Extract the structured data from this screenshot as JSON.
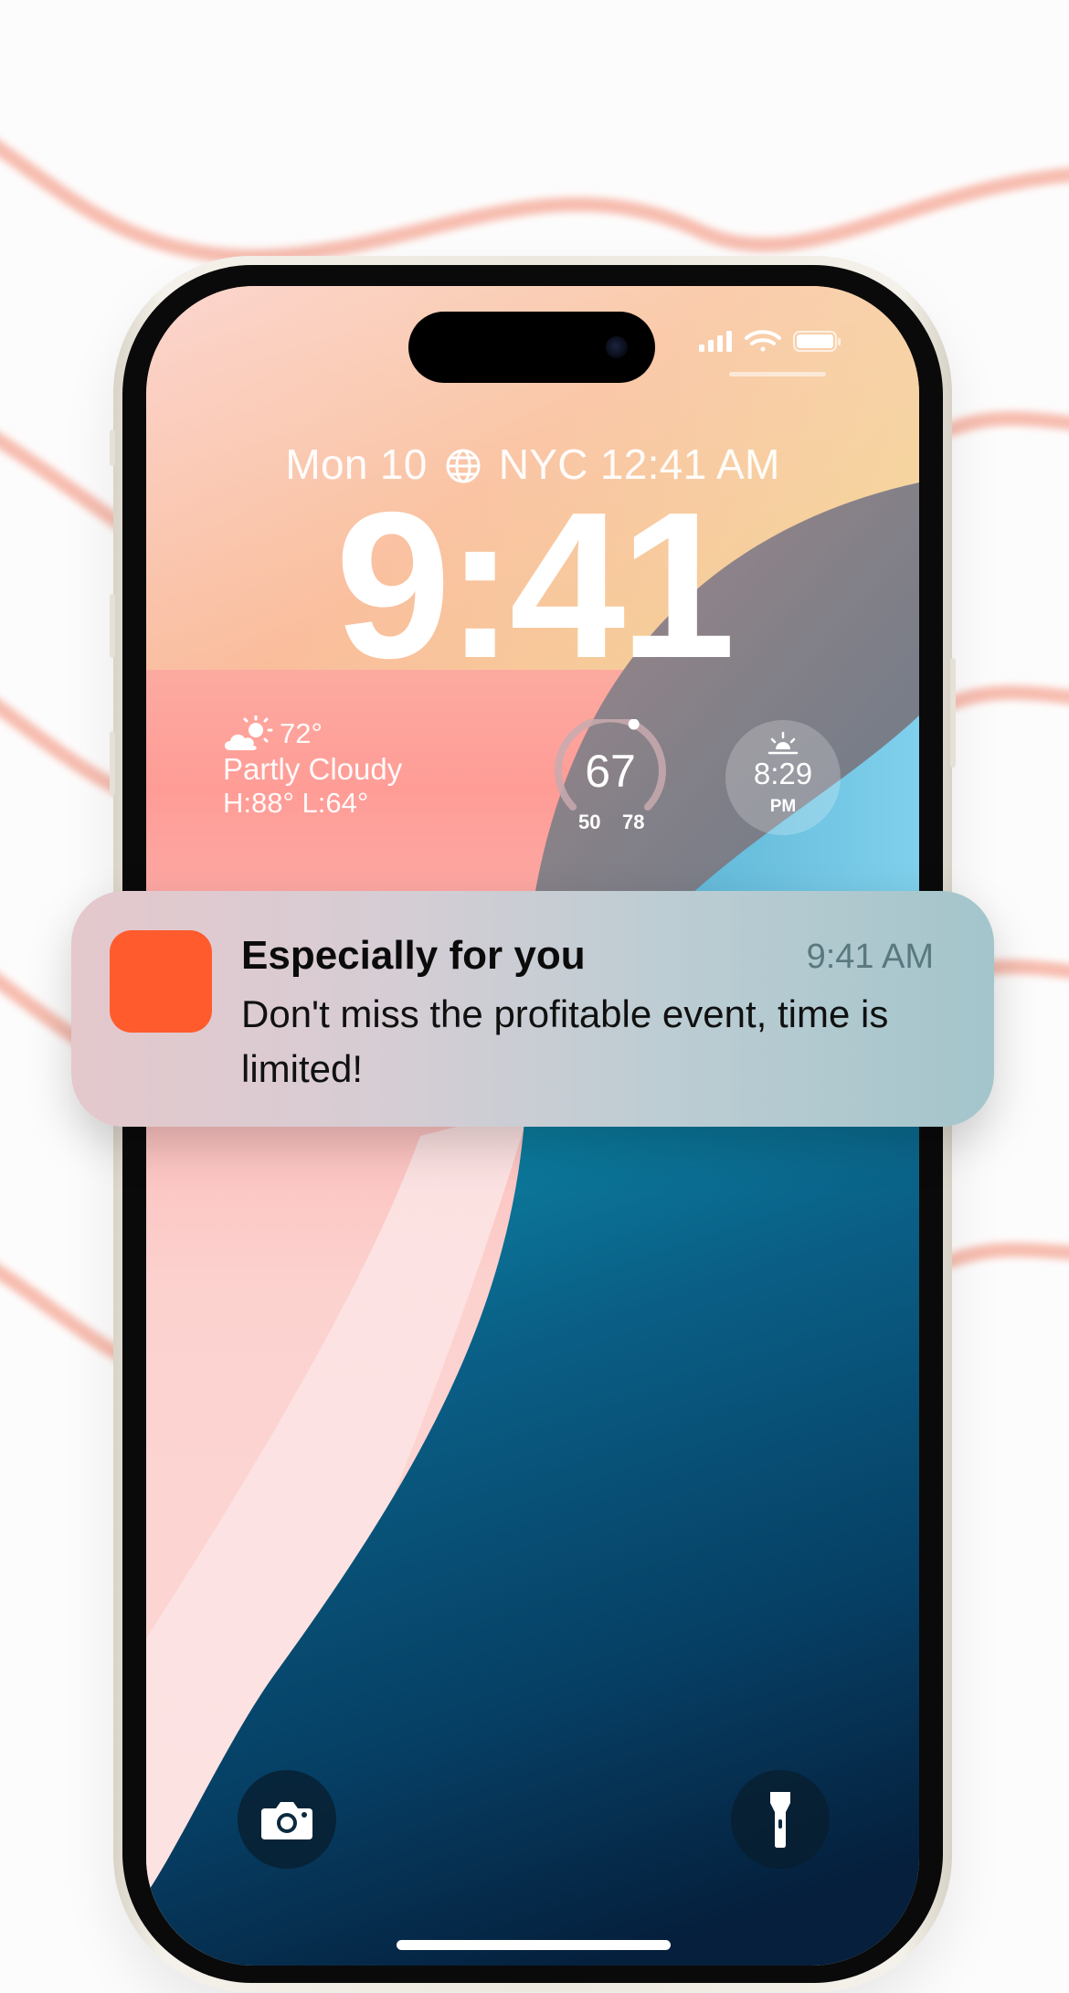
{
  "lockscreen": {
    "date_line": {
      "date": "Mon 10",
      "city_time": "NYC 12:41 AM"
    },
    "time": "9:41",
    "weather": {
      "icon": "partly-cloudy-icon",
      "temperature": "72°",
      "condition": "Partly Cloudy",
      "high_low": "H:88° L:64°"
    },
    "temperature_gauge": {
      "current": "67",
      "low": "50",
      "high": "78",
      "level_fraction": 0.6
    },
    "sunset": {
      "icon": "sunset-icon",
      "time": "8:29",
      "period": "PM"
    },
    "quick_actions": {
      "left": "camera-icon",
      "right": "flashlight-icon"
    }
  },
  "notification": {
    "icon_color": "#ff5b2c",
    "title": "Especially for you",
    "time": "9:41 AM",
    "body": "Don't miss the profitable event, time is limited!"
  },
  "colors": {
    "accent_wave": "#f4a998",
    "wallpaper_deep_blue": "#06324f",
    "wallpaper_teal": "#0b7d9f"
  }
}
